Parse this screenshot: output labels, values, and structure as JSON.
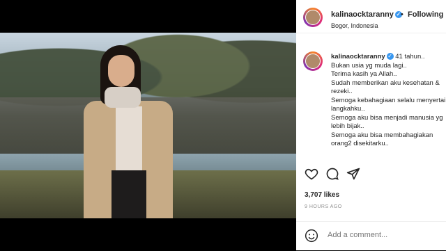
{
  "post": {
    "username": "kalinaocktaranny",
    "location": "Bogor, Indonesia",
    "follow_state": "Following",
    "separator": "•",
    "caption_lines": [
      "41 tahun..",
      "Bukan usia yg muda lagi..",
      "Terima kasih ya Allah..",
      "Sudah memberikan aku kesehatan &",
      "rezeki..",
      "Semoga kebahagiaan selalu menyertai",
      "langkahku..",
      "Semoga aku bisa menjadi manusia yg",
      "lebih bijak..",
      "Semoga aku bisa membahagiakan",
      "orang2 disekitarku.."
    ],
    "likes": "3,707 likes",
    "timestamp": "9 HOURS AGO",
    "comment_placeholder": "Add a comment..."
  },
  "icons": [
    "heart-icon",
    "comment-icon",
    "share-icon",
    "smile-icon",
    "verified-icon"
  ],
  "colors": {
    "link_blue": "#3897f0",
    "text": "#262626",
    "muted": "#8e8e8e"
  }
}
